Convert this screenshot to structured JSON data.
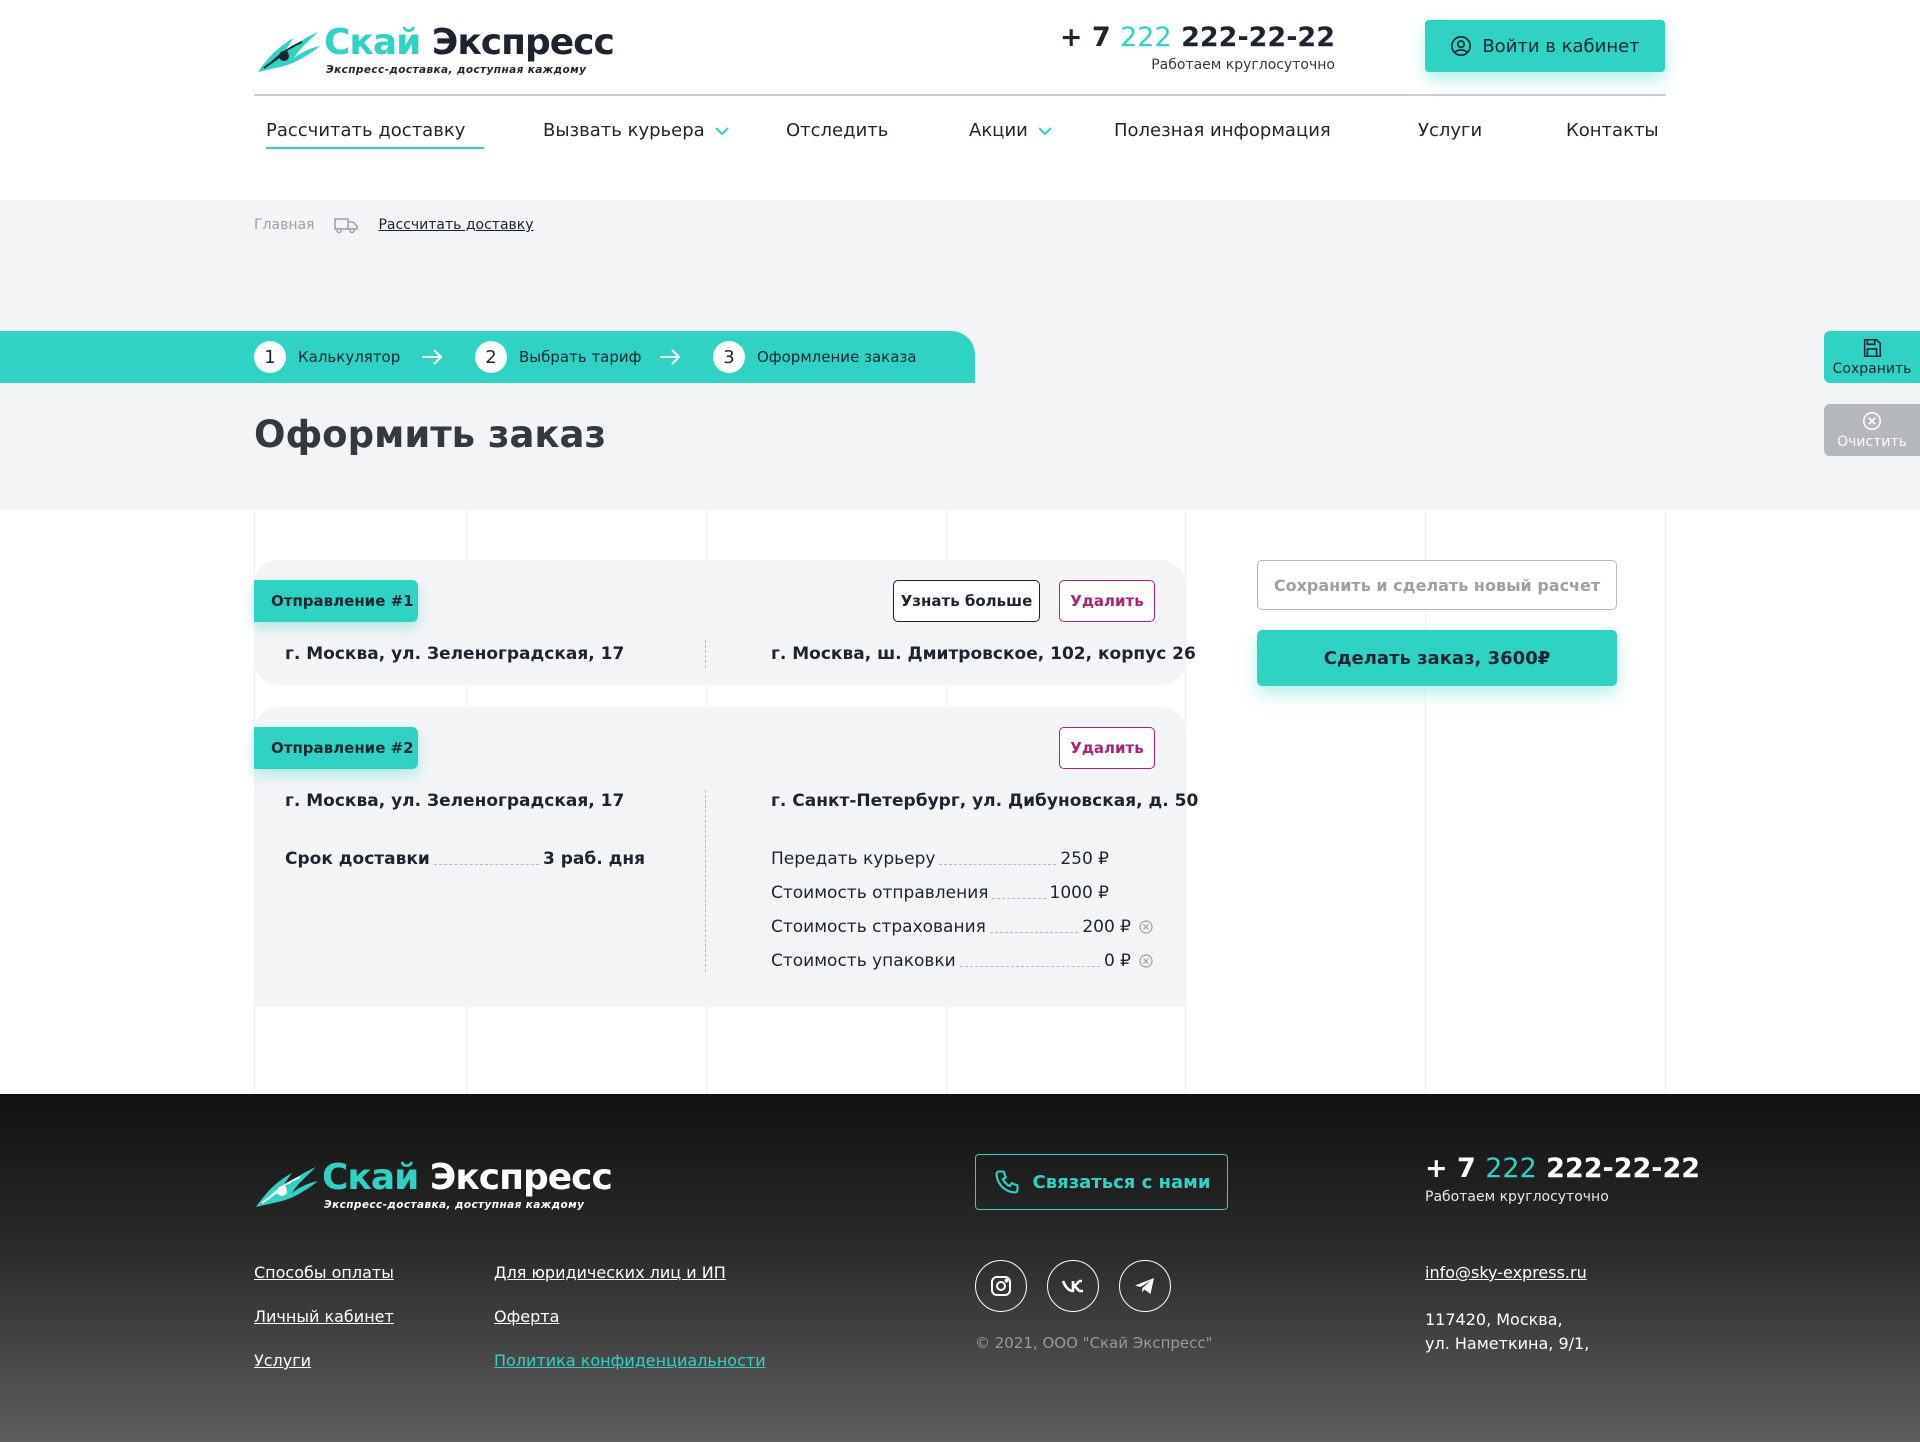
{
  "colors": {
    "accent": "#2fd3c5",
    "dark": "#1d2430",
    "danger": "#a8227a",
    "hero_bg": "#f3f4f6"
  },
  "header": {
    "logo": {
      "name_part1": "Скай",
      "name_part2": "Экспресс",
      "tagline": "Экспресс-доставка, доступная каждому",
      "icon": "winged-logo-icon"
    },
    "phone": {
      "prefix": "+ 7",
      "code": "222",
      "number": "222-22-22",
      "note": "Работаем круглосуточно"
    },
    "login_button": {
      "label": "Войти в кабинет",
      "icon": "user-circle-icon"
    }
  },
  "nav": {
    "items": [
      {
        "label": "Рассчитать доставку",
        "active": true
      },
      {
        "label": "Вызвать курьера",
        "dropdown": true
      },
      {
        "label": "Отследить"
      },
      {
        "label": "Акции",
        "dropdown": true
      },
      {
        "label": "Полезная информация"
      },
      {
        "label": "Услуги"
      },
      {
        "label": "Контакты"
      }
    ]
  },
  "breadcrumb": {
    "home": "Главная",
    "current": "Рассчитать доставку",
    "separator_icon": "truck-icon"
  },
  "stepper": {
    "steps": [
      {
        "num": "1",
        "label": "Калькулятор"
      },
      {
        "num": "2",
        "label": "Выбрать тариф"
      },
      {
        "num": "3",
        "label": "Оформление заказа"
      }
    ]
  },
  "page_title": "Оформить заказ",
  "side_actions": {
    "save": "Сохранить",
    "clear": "Очистить"
  },
  "shipments": [
    {
      "tag": "Отправление #1",
      "learn_more": "Узнать больше",
      "delete": "Удалить",
      "from": "г. Москва, ул. Зеленоградская, 17",
      "to": "г. Москва, ш. Дмитровское, 102, корпус 26"
    },
    {
      "tag": "Отправление #2",
      "delete": "Удалить",
      "from": "г. Москва, ул. Зеленоградская, 17",
      "to": "г. Санкт-Петербург, ул. Дибуновская, д. 50",
      "delivery_term_label": "Срок доставки",
      "delivery_term_value": "3 раб. дня",
      "costs": [
        {
          "label": "Передать курьеру",
          "value": "250 ₽",
          "removable": false
        },
        {
          "label": "Стоимость отправления",
          "value": "1000 ₽",
          "removable": false
        },
        {
          "label": "Стоимость страхования",
          "value": "200 ₽",
          "removable": true
        },
        {
          "label": "Стоимость упаковки",
          "value": "0 ₽",
          "removable": true
        }
      ]
    }
  ],
  "summary": {
    "save_new": "Сохранить и сделать новый расчет",
    "order": "Сделать заказ, 3600₽"
  },
  "footer": {
    "logo": {
      "name_part1": "Скай",
      "name_part2": "Экспресс",
      "tagline": "Экспресс-доставка, доступная каждому"
    },
    "contact_button": "Связаться с нами",
    "phone": {
      "prefix": "+ 7",
      "code": "222",
      "number": "222-22-22",
      "note": "Работаем круглосуточно"
    },
    "links_col1": [
      "Способы оплаты",
      "Личный кабинет",
      "Услуги"
    ],
    "links_col2": [
      "Для юридических лиц и ИП",
      "Оферта",
      "Политика конфиденциальности"
    ],
    "social": [
      "instagram-icon",
      "vk-icon",
      "telegram-icon"
    ],
    "copyright": "© 2021, ООО \"Скай Экспресс\"",
    "email": "info@sky-express.ru",
    "address_line1": "117420, Москва,",
    "address_line2": "ул. Наметкина, 9/1,"
  }
}
